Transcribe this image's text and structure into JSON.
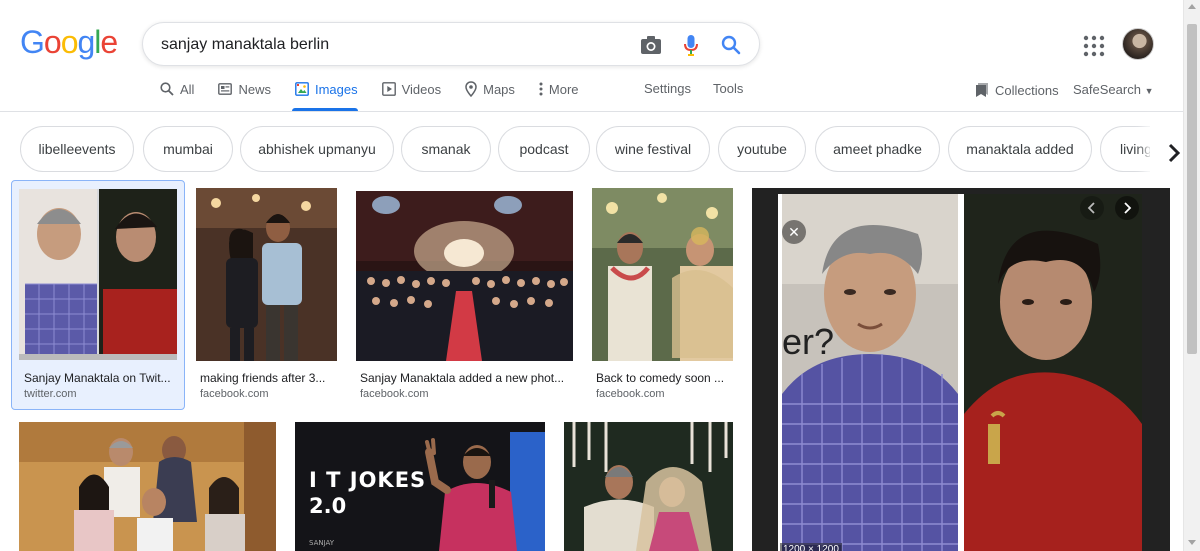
{
  "logo": {
    "text": "Google"
  },
  "search": {
    "query": "sanjay manaktala berlin"
  },
  "tabs": [
    {
      "label": "All",
      "icon": "search-icon"
    },
    {
      "label": "News",
      "icon": "news-icon"
    },
    {
      "label": "Images",
      "icon": "image-icon",
      "active": true
    },
    {
      "label": "Videos",
      "icon": "video-icon"
    },
    {
      "label": "Maps",
      "icon": "map-pin-icon"
    },
    {
      "label": "More",
      "icon": "more-vertical-icon"
    }
  ],
  "toolbar": {
    "settings": "Settings",
    "tools": "Tools",
    "collections": "Collections",
    "safesearch": "SafeSearch"
  },
  "chips": [
    "libelleevents",
    "mumbai",
    "abhishek upmanyu",
    "smanak",
    "podcast",
    "wine festival",
    "youtube",
    "ameet phadke",
    "manaktala added",
    "living"
  ],
  "results": [
    {
      "caption": "Sanjay Manaktala on Twit...",
      "source": "twitter.com"
    },
    {
      "caption": "making friends after 3...",
      "source": "facebook.com"
    },
    {
      "caption": "Sanjay Manaktala added a new phot...",
      "source": "facebook.com"
    },
    {
      "caption": "Back to comedy soon ...",
      "source": "facebook.com"
    }
  ],
  "poster": {
    "line1": "I T JOKES",
    "line2": "2.0",
    "line3": "SANJAY"
  },
  "preview": {
    "overlay_text": "er?",
    "dimensions": "1200 × 1200"
  },
  "colors": {
    "accent": "#1a73e8",
    "chip_border": "#dadce0",
    "selected_bg": "#e8f0fe"
  }
}
